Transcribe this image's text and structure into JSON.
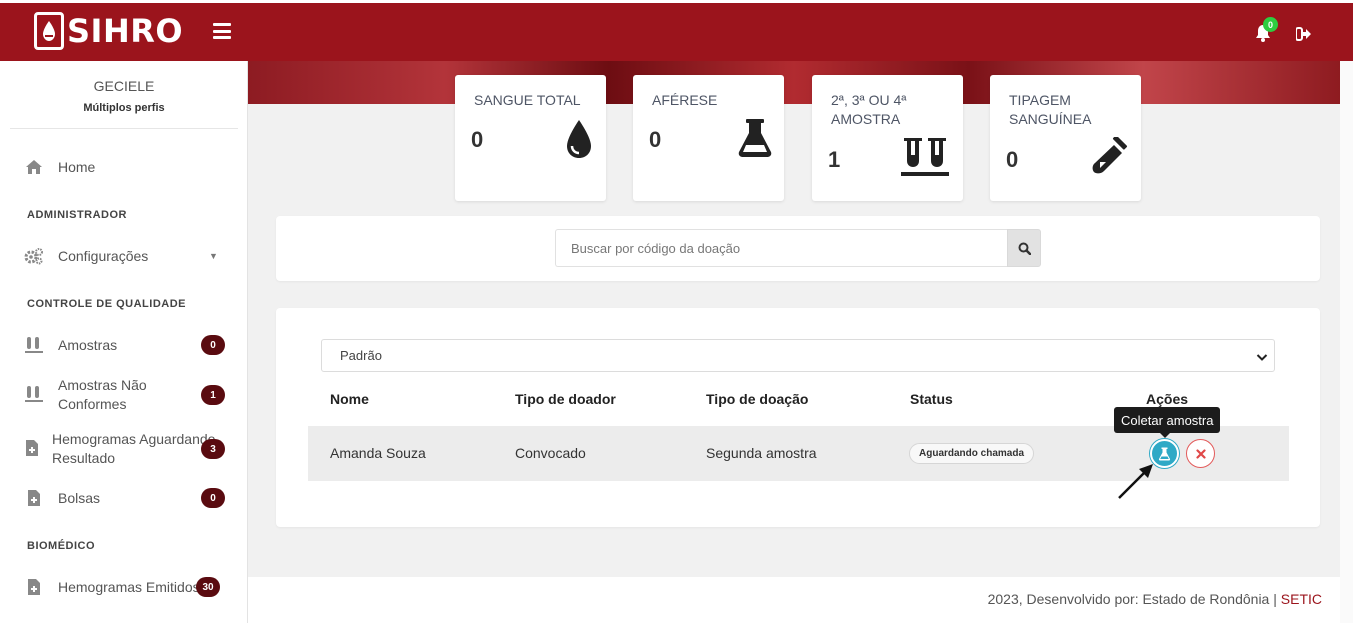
{
  "app": {
    "logo_text": "SIHRO",
    "notification_count": "0",
    "colors": {
      "brand": "#9b141c",
      "badge": "#5a0b10",
      "action_collect": "#2fa9c6",
      "action_cancel": "#e35b5b",
      "notification": "#2ecc40"
    }
  },
  "header": {
    "menu_icon": "hamburger-icon",
    "bell_icon": "bell-icon",
    "logout_icon": "sign-out-icon"
  },
  "user": {
    "name": "GECIELE",
    "profile": "Múltiplos perfis"
  },
  "sidebar": {
    "home": {
      "label": "Home",
      "icon": "home-icon"
    },
    "sections": {
      "admin": "ADMINISTRADOR",
      "quality": "CONTROLE DE QUALIDADE",
      "biomedical": "BIOMÉDICO"
    },
    "config": {
      "label": "Configurações",
      "icon": "gears-icon"
    },
    "amostras": {
      "label": "Amostras",
      "badge": "0",
      "icon": "test-tubes-icon"
    },
    "nao_conformes": {
      "label_line1": "Amostras Não",
      "label_line2": "Conformes",
      "badge": "1",
      "icon": "test-tubes-icon"
    },
    "hemogramas_aguardando": {
      "label_line1": "Hemogramas Aguardando",
      "label_line2": "Resultado",
      "badge": "3",
      "icon": "file-medical-icon"
    },
    "bolsas": {
      "label": "Bolsas",
      "badge": "0",
      "icon": "file-medical-icon"
    },
    "hemogramas_emitidos": {
      "label": "Hemogramas Emitidos",
      "badge": "30",
      "icon": "file-medical-icon"
    }
  },
  "cards": [
    {
      "title": "SANGUE TOTAL",
      "value": "0",
      "icon": "tint-icon"
    },
    {
      "title": "AFÉRESE",
      "value": "0",
      "icon": "flask-icon"
    },
    {
      "title": "2ª, 3ª OU 4ª AMOSTRA",
      "value": "1",
      "icon": "test-tubes-icon"
    },
    {
      "title": "TIPAGEM SANGUÍNEA",
      "value": "0",
      "icon": "vial-icon"
    }
  ],
  "search": {
    "placeholder": "Buscar por código da doação",
    "icon": "search-icon"
  },
  "filter": {
    "selected": "Padrão"
  },
  "table": {
    "headers": [
      "Nome",
      "Tipo de doador",
      "Tipo de doação",
      "Status",
      "Ações"
    ],
    "rows": [
      {
        "nome": "Amanda Souza",
        "tipo_doador": "Convocado",
        "tipo_doacao": "Segunda amostra",
        "status": "Aguardando chamada"
      }
    ],
    "tooltip": "Coletar amostra"
  },
  "footer": {
    "text": "2023, Desenvolvido por: Estado de Rondônia | ",
    "link": "SETIC"
  }
}
